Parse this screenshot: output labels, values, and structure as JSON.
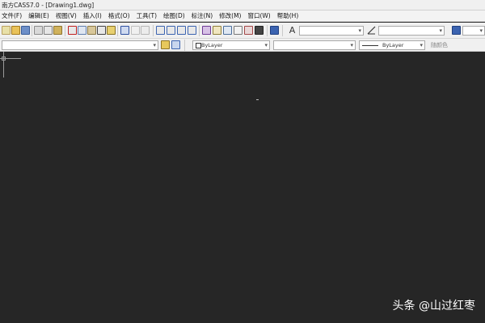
{
  "window": {
    "title": "南方CASS7.0 - [Drawing1.dwg]"
  },
  "menubar": {
    "items": [
      "文件(F)",
      "编辑(E)",
      "视图(V)",
      "插入(I)",
      "格式(O)",
      "工具(T)",
      "绘图(D)",
      "标注(N)",
      "修改(M)",
      "窗口(W)",
      "帮助(H)"
    ]
  },
  "toolbar": {
    "text_style_combo": "",
    "dim_style_combo": ""
  },
  "properties": {
    "layer_combo": "",
    "color_combo": "ByLayer",
    "linetype_combo": "",
    "lineweight_combo": "ByLayer",
    "plotstyle_label": "随颜色"
  },
  "watermark": "头条 @山过红枣"
}
